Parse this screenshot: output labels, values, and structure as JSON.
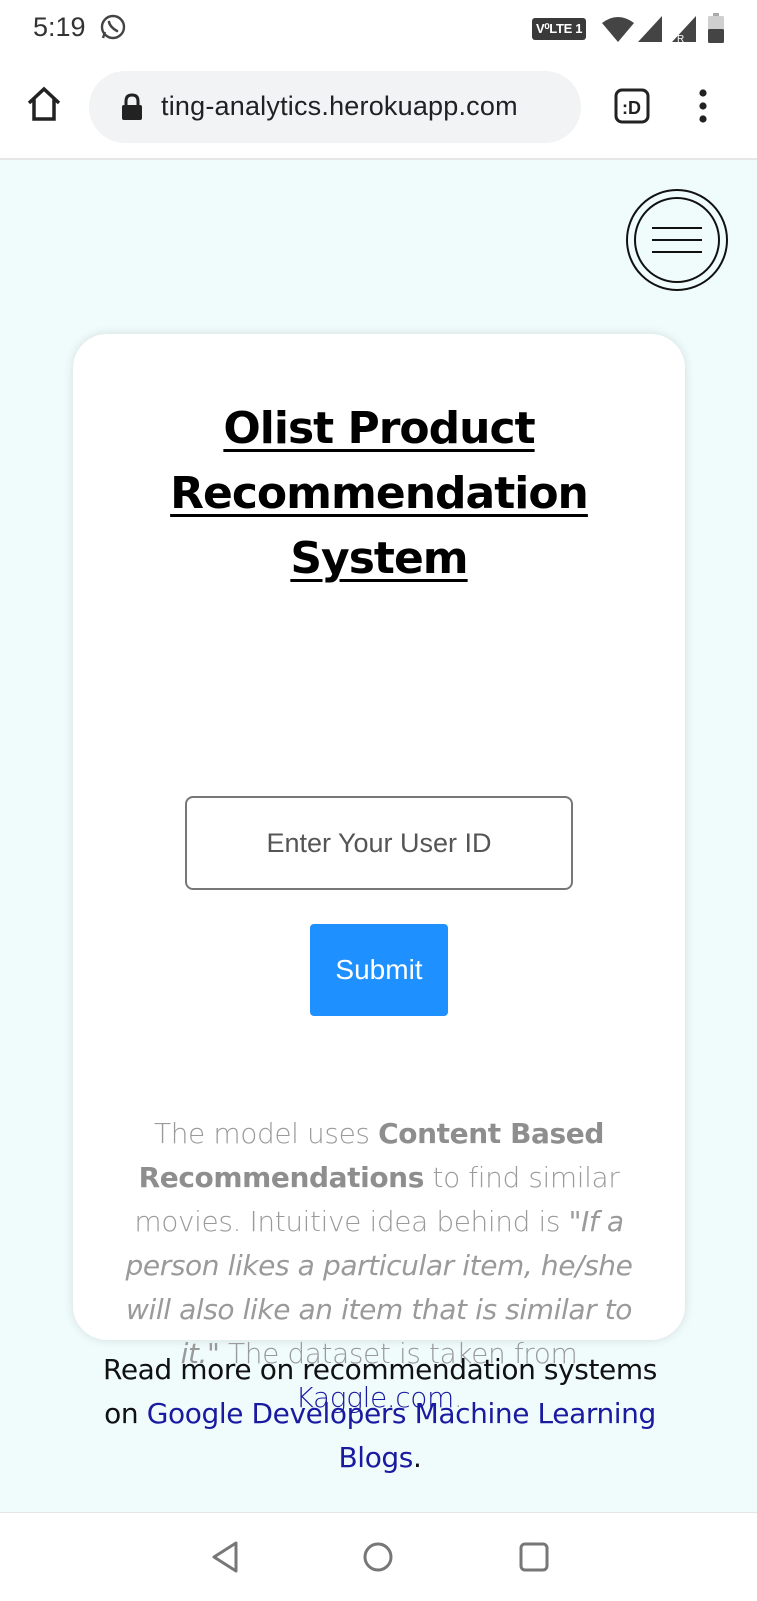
{
  "status_bar": {
    "time": "5:19",
    "network_badge": "V⁰LTE 1",
    "icons": [
      "whatsapp-icon",
      "wifi-icon",
      "signal-icon",
      "signal-roaming-icon",
      "battery-icon"
    ]
  },
  "browser": {
    "url": "ting-analytics.herokuapp.com",
    "icons": [
      "home-icon",
      "lock-icon",
      "extension-icon",
      "more-vert-icon"
    ]
  },
  "page": {
    "background_color": "#f0fcfc",
    "menu_icon": "hamburger-menu-icon",
    "card": {
      "title": "Olist Product Recommendation System",
      "input_placeholder": "Enter Your User ID",
      "submit_label": "Submit",
      "submit_color": "#1e90ff",
      "description": {
        "part1": "The model uses ",
        "bold": "Content Based Recommendations",
        "part2": " to find similar movies. Intuitive idea behind is ",
        "quote": "\"If a person likes a particular item, he/she will also like an item that is similar to it.\"",
        "part3": " The dataset is taken from ",
        "link_text": "Kaggle.com",
        "part4": "."
      }
    },
    "footer": {
      "part1": "Read more on recommendation systems on ",
      "link_text": "Google Developers Machine Learning Blogs",
      "part2": "."
    },
    "link_color": "#1a1aa0"
  },
  "nav_bar": {
    "icons": [
      "back-icon",
      "home-circle-icon",
      "recents-icon"
    ]
  }
}
